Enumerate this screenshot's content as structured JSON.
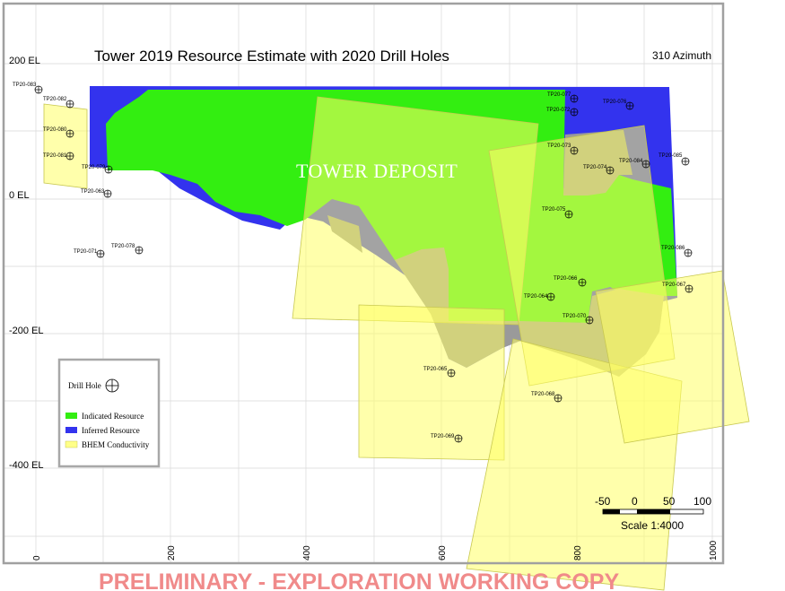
{
  "map": {
    "title": "Tower 2019 Resource Estimate with 2020 Drill Holes",
    "azimuth": "310 Azimuth",
    "deposit_label": "TOWER DEPOSIT",
    "footer": "PRELIMINARY - EXPLORATION WORKING COPY",
    "elevation_labels": [
      "200 EL",
      "0 EL",
      "-200 EL",
      "-400 EL"
    ],
    "x_ticks": [
      "0",
      "200",
      "400",
      "600",
      "800",
      "1000"
    ],
    "legend": {
      "drill_hole": "Drill Hole",
      "indicated": "Indicated Resource",
      "inferred": "Inferred Resource",
      "bhem": "BHEM Conductivity"
    },
    "scale": {
      "ticks": [
        "-50",
        "0",
        "50",
        "100"
      ],
      "label": "Scale 1:4000"
    },
    "colors": {
      "indicated": "#33ee11",
      "inferred": "#3333ee",
      "overlap": "#9a9a9a",
      "bhem": "#ffff66"
    },
    "drill_holes": [
      {
        "id": "TP20-083"
      },
      {
        "id": "TP20-082"
      },
      {
        "id": "TP20-080"
      },
      {
        "id": "TP20-081"
      },
      {
        "id": "TP20-079"
      },
      {
        "id": "TP20-063"
      },
      {
        "id": "TP20-071"
      },
      {
        "id": "TP20-078"
      },
      {
        "id": "TP20-077"
      },
      {
        "id": "TP20-072"
      },
      {
        "id": "TP20-076"
      },
      {
        "id": "TP20-073"
      },
      {
        "id": "TP20-074"
      },
      {
        "id": "TP20-084"
      },
      {
        "id": "TP20-085"
      },
      {
        "id": "TP20-075"
      },
      {
        "id": "TP20-086"
      },
      {
        "id": "TP20-066"
      },
      {
        "id": "TP20-064"
      },
      {
        "id": "TP20-067"
      },
      {
        "id": "TP20-070"
      },
      {
        "id": "TP20-065"
      },
      {
        "id": "TP20-068"
      },
      {
        "id": "TP20-069"
      }
    ]
  }
}
